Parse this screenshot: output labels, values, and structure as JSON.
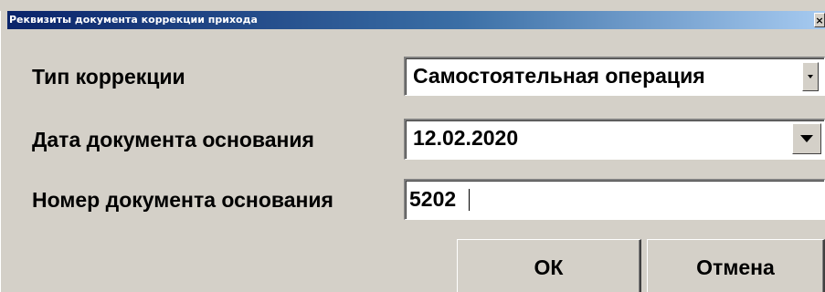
{
  "window": {
    "title": "Реквизиты документа коррекции прихода",
    "close_label": "×"
  },
  "form": {
    "correction_type": {
      "label": "Тип коррекции",
      "value": "Самостоятельная операция"
    },
    "basis_date": {
      "label": "Дата документа основания",
      "value": "12.02.2020"
    },
    "basis_number": {
      "label": "Номер документа основания",
      "value": "5202"
    }
  },
  "buttons": {
    "ok_label": "ОК",
    "cancel_label": "Отмена"
  },
  "icons": {
    "close": "close-icon",
    "dropdown": "chevron-down-icon"
  },
  "colors": {
    "titlebar_start": "#0a246a",
    "titlebar_end": "#a6caf0",
    "face": "#d4d0c8"
  }
}
